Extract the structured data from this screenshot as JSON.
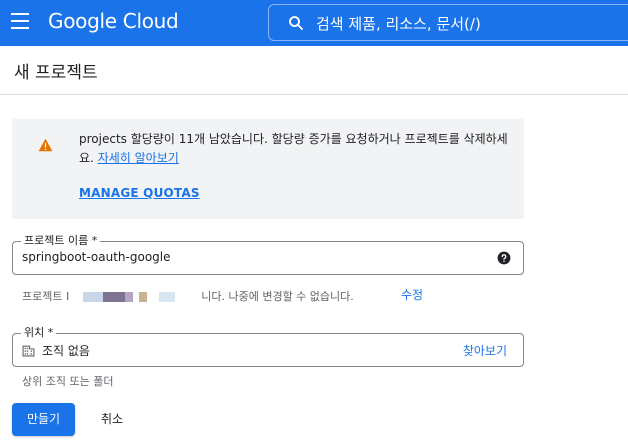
{
  "colors": {
    "brand_blue": "#1a73e8",
    "warning": "#e37400"
  },
  "topbar": {
    "logo": "Google Cloud",
    "search": {
      "placeholder": "검색   제품, 리소스, 문서(/)",
      "icon": "search-icon"
    },
    "menu_icon": "hamburger-menu-icon"
  },
  "page": {
    "title": "새 프로젝트"
  },
  "notice": {
    "icon": "warning-icon",
    "text": "projects 할당량이 11개 남았습니다. 할당량 증가를 요청하거나 프로젝트를 삭제하세요.",
    "learn_more": "자세히 알아보기",
    "manage_quotas": "MANAGE QUOTAS"
  },
  "project_name": {
    "label": "프로젝트 이름 *",
    "value": "springboot-oauth-google",
    "help_icon": "help-icon"
  },
  "project_id": {
    "prefix": "프로젝트 I",
    "suffix": "니다. 나중에 변경할 수 없습니다.",
    "edit": "수정"
  },
  "location": {
    "label": "위치 *",
    "value": "조직 없음",
    "browse": "찾아보기",
    "helper": "상위 조직 또는 폴더",
    "icon": "organization-icon"
  },
  "actions": {
    "create": "만들기",
    "cancel": "취소"
  }
}
